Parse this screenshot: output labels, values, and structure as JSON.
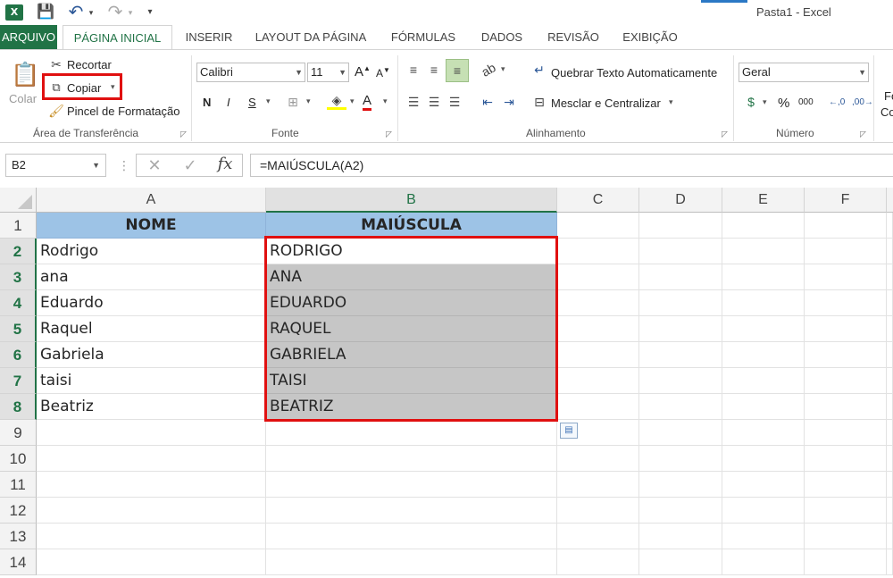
{
  "window": {
    "app_logo": "X",
    "title": "Pasta1 - Excel"
  },
  "quick_access": {
    "save_icon": "💾",
    "undo_icon": "↶",
    "redo_icon": "↷",
    "customize_icon": "▾"
  },
  "tabs": [
    {
      "label": "ARQUIVO"
    },
    {
      "label": "PÁGINA INICIAL"
    },
    {
      "label": "INSERIR"
    },
    {
      "label": "LAYOUT DA PÁGINA"
    },
    {
      "label": "FÓRMULAS"
    },
    {
      "label": "DADOS"
    },
    {
      "label": "REVISÃO"
    },
    {
      "label": "EXIBIÇÃO"
    }
  ],
  "ribbon": {
    "clipboard": {
      "paste_label": "Colar",
      "cut_label": "Recortar",
      "copy_label": "Copiar",
      "format_painter_label": "Pincel de Formatação",
      "group_label": "Área de Transferência"
    },
    "font": {
      "font_name": "Calibri",
      "font_size": "11",
      "grow_label": "A",
      "shrink_label": "A",
      "bold": "N",
      "italic": "I",
      "underline": "S",
      "font_color_label": "A",
      "group_label": "Fonte"
    },
    "alignment": {
      "wrap_text_label": "Quebrar Texto Automaticamente",
      "merge_center_label": "Mesclar e Centralizar",
      "group_label": "Alinhamento"
    },
    "number": {
      "format": "Geral",
      "percent": "%",
      "thousands": "000",
      "increase_decimal": "←,0",
      "decrease_decimal": ",00→",
      "group_label": "Número"
    },
    "styles_partial": {
      "line1": "Fo",
      "line2": "Co"
    }
  },
  "formula_bar": {
    "name_box": "B2",
    "cancel_icon": "✕",
    "enter_icon": "✓",
    "fx_label": "fx",
    "formula": "=MAIÚSCULA(A2)"
  },
  "sheet": {
    "columns": [
      "A",
      "B",
      "C",
      "D",
      "E",
      "F"
    ],
    "rows": [
      "1",
      "2",
      "3",
      "4",
      "5",
      "6",
      "7",
      "8",
      "9",
      "10",
      "11",
      "12",
      "13",
      "14"
    ],
    "header_row": {
      "a": "NOME",
      "b": "MAIÚSCULA"
    },
    "data": [
      {
        "a": "Rodrigo",
        "b": "RODRIGO"
      },
      {
        "a": "ana",
        "b": "ANA"
      },
      {
        "a": "Eduardo",
        "b": "EDUARDO"
      },
      {
        "a": "Raquel",
        "b": "RAQUEL"
      },
      {
        "a": "Gabriela",
        "b": "GABRIELA"
      },
      {
        "a": "taisi",
        "b": "TAISI"
      },
      {
        "a": "Beatriz",
        "b": "BEATRIZ"
      }
    ],
    "colors": {
      "header_fill": "#9dc3e6",
      "selection_fill": "#c6c6c6",
      "highlight": "#e01010",
      "excel_green": "#217346"
    }
  }
}
